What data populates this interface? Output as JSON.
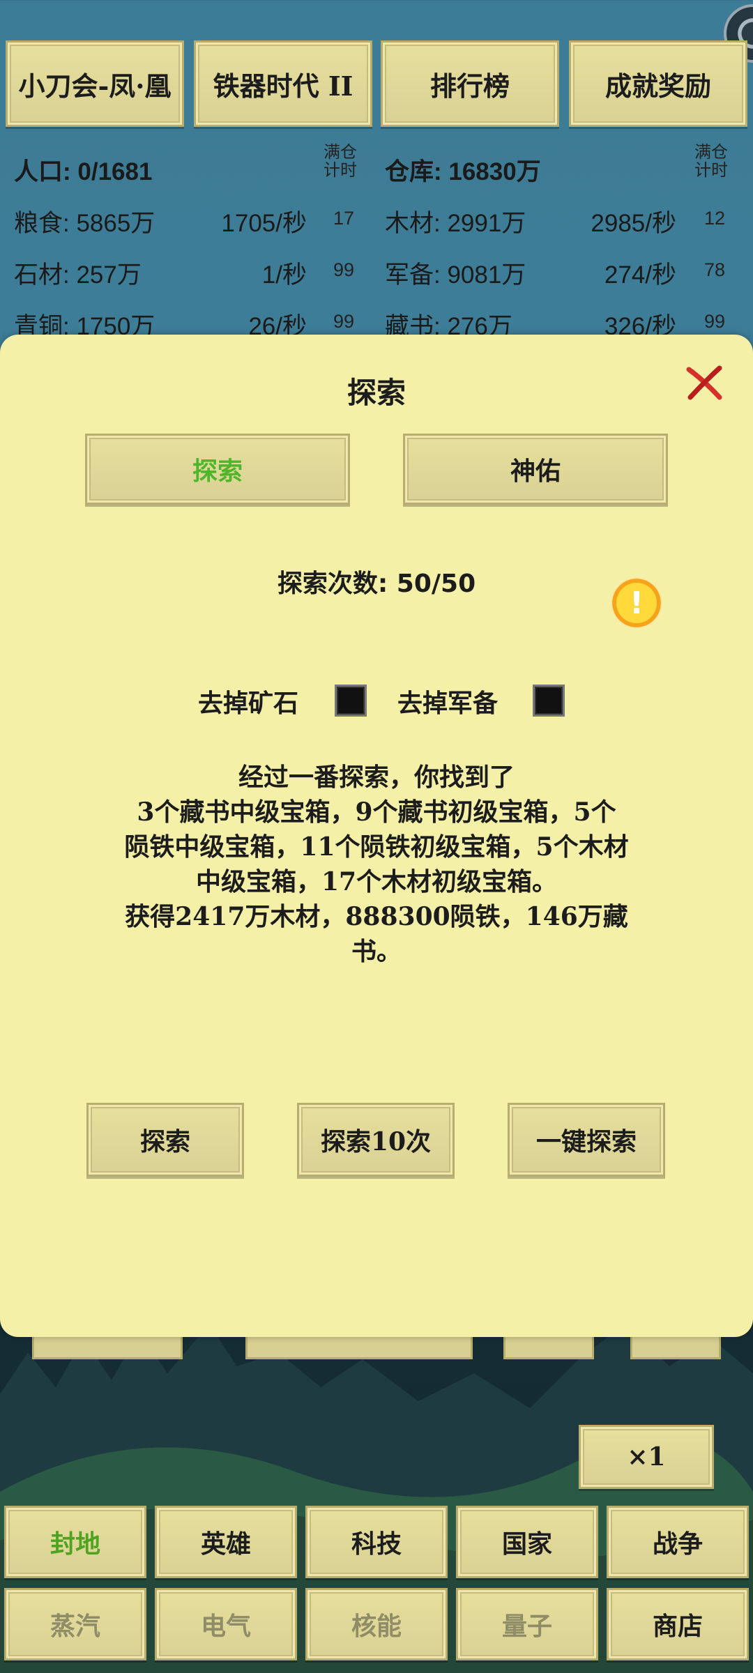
{
  "top_nav": {
    "guild": "小刀会-凤·凰",
    "era": "铁器时代 II",
    "ranking": "排行榜",
    "achievement": "成就奖励"
  },
  "resources": {
    "population": "人口: 0/1681",
    "full_timer_label": [
      "满仓",
      "计时"
    ],
    "warehouse": "仓库: 16830万",
    "rows": [
      {
        "left_name": "粮食: 5865万",
        "left_rate": "1705/秒",
        "left_timer": "17",
        "right_name": "木材: 2991万",
        "right_rate": "2985/秒",
        "right_timer": "12"
      },
      {
        "left_name": "石材: 257万",
        "left_rate": "1/秒",
        "left_timer": "99",
        "right_name": "军备: 9081万",
        "right_rate": "274/秒",
        "right_timer": "78"
      },
      {
        "left_name": "青铜: 1750万",
        "left_rate": "26/秒",
        "left_timer": "99",
        "right_name": "藏书: 276万",
        "right_rate": "326/秒",
        "right_timer": "99"
      }
    ]
  },
  "modal": {
    "title": "探索",
    "tabs": [
      {
        "label": "探索",
        "active": true
      },
      {
        "label": "神佑",
        "active": false
      }
    ],
    "count_text": "探索次数: 50/50",
    "options": [
      {
        "label": "去掉矿石",
        "checked": false
      },
      {
        "label": "去掉军备",
        "checked": false
      }
    ],
    "result_lines": [
      "经过一番探索，你找到了",
      "3个藏书中级宝箱，9个藏书初级宝箱，5个",
      "陨铁中级宝箱，11个陨铁初级宝箱，5个木材",
      "中级宝箱，17个木材初级宝箱。",
      "获得2417万木材，888300陨铁，146万藏",
      "书。"
    ],
    "actions": {
      "explore": "探索",
      "explore10": "探索10次",
      "auto": "一键探索"
    },
    "colors": {
      "active_tab": "#4fb52a",
      "panel_bg": "#f4f0a8"
    }
  },
  "speed": "×1",
  "bottom_nav": {
    "row1": [
      {
        "label": "封地",
        "state": "active"
      },
      {
        "label": "英雄",
        "state": "normal"
      },
      {
        "label": "科技",
        "state": "normal"
      },
      {
        "label": "国家",
        "state": "normal"
      },
      {
        "label": "战争",
        "state": "normal"
      }
    ],
    "row2": [
      {
        "label": "蒸汽",
        "state": "disabled"
      },
      {
        "label": "电气",
        "state": "disabled"
      },
      {
        "label": "核能",
        "state": "disabled"
      },
      {
        "label": "量子",
        "state": "disabled"
      },
      {
        "label": "商店",
        "state": "normal"
      }
    ]
  }
}
